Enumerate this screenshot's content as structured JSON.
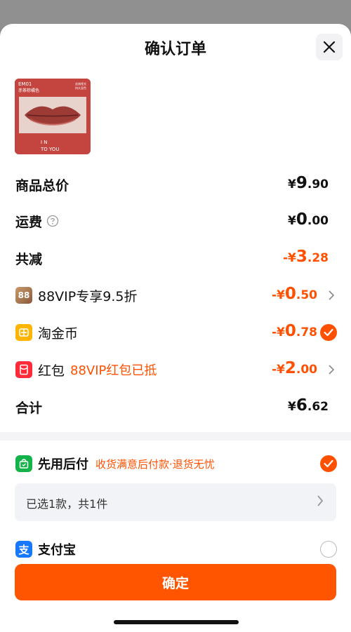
{
  "header": {
    "title": "确认订单"
  },
  "product": {
    "code": "EM01",
    "shade": "赤茶棕橘色",
    "tag_line1": "丝绒哑光",
    "tag_line2": "持久显色",
    "brand_line1": "I N",
    "brand_line2": "TO YOU"
  },
  "summary": {
    "subtotal": {
      "label": "商品总价",
      "yen": "¥",
      "int": "9",
      "dec": ".90"
    },
    "shipping": {
      "label": "运费",
      "help_icon": "question-circle-icon",
      "yen": "¥",
      "int": "0",
      "dec": ".00"
    },
    "discount_total": {
      "label": "共减",
      "yen": "-¥",
      "int": "3",
      "dec": ".28"
    },
    "vip": {
      "badge": "88",
      "label": "88VIP专享9.5折",
      "yen": "-¥",
      "int": "0",
      "dec": ".50"
    },
    "coins": {
      "label": "淘金币",
      "yen": "-¥",
      "int": "0",
      "dec": ".78"
    },
    "redpacket": {
      "label": "红包",
      "note": "88VIP红包已抵",
      "yen": "-¥",
      "int": "2",
      "dec": ".00"
    },
    "total": {
      "label": "合计",
      "yen": "¥",
      "int": "6",
      "dec": ".62"
    }
  },
  "payment": {
    "paylater": {
      "label": "先用后付",
      "note": "收货满意后付款·退货无忧",
      "selected": true
    },
    "selection": {
      "text": "已选1款，共1件"
    },
    "alipay": {
      "label": "支付宝",
      "selected": false
    }
  },
  "footer": {
    "confirm_label": "确定"
  },
  "colors": {
    "accent": "#ff5000",
    "button": "#ff5500",
    "text": "#111111"
  }
}
